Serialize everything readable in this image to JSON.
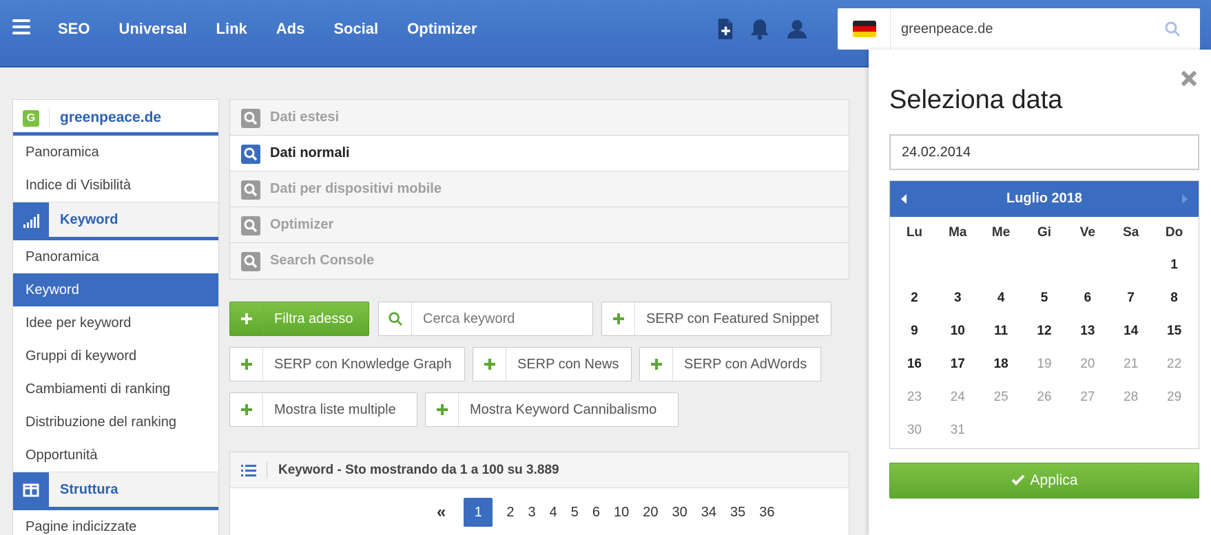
{
  "topbar": {
    "nav": [
      "SEO",
      "Universal",
      "Link",
      "Ads",
      "Social",
      "Optimizer"
    ],
    "icons": [
      "new-document-icon",
      "bell-icon",
      "user-icon"
    ],
    "domain_value": "greenpeace.de",
    "country_flag": "germany-flag-icon"
  },
  "sidebar": {
    "project_name": "greenpeace.de",
    "items_top": [
      "Panoramica",
      "Indice di Visibilità"
    ],
    "section_keyword": "Keyword",
    "items_keyword": [
      "Panoramica",
      "Keyword",
      "Idee per keyword",
      "Gruppi di keyword",
      "Cambiamenti di ranking",
      "Distribuzione del ranking",
      "Opportunità"
    ],
    "section_struttura": "Struttura",
    "items_struttura": [
      "Pagine indicizzate"
    ]
  },
  "datatypes": [
    "Dati estesi",
    "Dati normali",
    "Dati per dispositivi mobile",
    "Optimizer",
    "Search Console"
  ],
  "filters": {
    "filter_now": "Filtra adesso",
    "search_placeholder": "Cerca keyword",
    "featured_snippet": "SERP con Featured Snippet",
    "knowledge_graph": "SERP con Knowledge Graph",
    "news": "SERP con News",
    "adwords": "SERP con AdWords",
    "multi_lists": "Mostra liste multiple",
    "cannibalism": "Mostra Keyword Cannibalismo"
  },
  "table": {
    "title": "Keyword - Sto mostrando da 1 a 100 su 3.889",
    "first": "«",
    "pages": [
      "1",
      "2",
      "3",
      "4",
      "5",
      "6",
      "10",
      "20",
      "30",
      "34",
      "35",
      "36"
    ]
  },
  "datepicker": {
    "title": "Seleziona data",
    "date_value": "24.02.2014",
    "month": "Luglio 2018",
    "weekdays": [
      "Lu",
      "Ma",
      "Me",
      "Gi",
      "Ve",
      "Sa",
      "Do"
    ],
    "active_days": [
      "1",
      "2",
      "3",
      "4",
      "5",
      "6",
      "7",
      "8",
      "9",
      "10",
      "11",
      "12",
      "13",
      "14",
      "15",
      "16",
      "17",
      "18"
    ],
    "disabled_days": [
      "19",
      "20",
      "21",
      "22",
      "23",
      "24",
      "25",
      "26",
      "27",
      "28",
      "29",
      "30",
      "31"
    ],
    "apply_label": "Applica"
  },
  "colors": {
    "primary": "#3a6cbf",
    "accent_green": "#6db33f"
  }
}
